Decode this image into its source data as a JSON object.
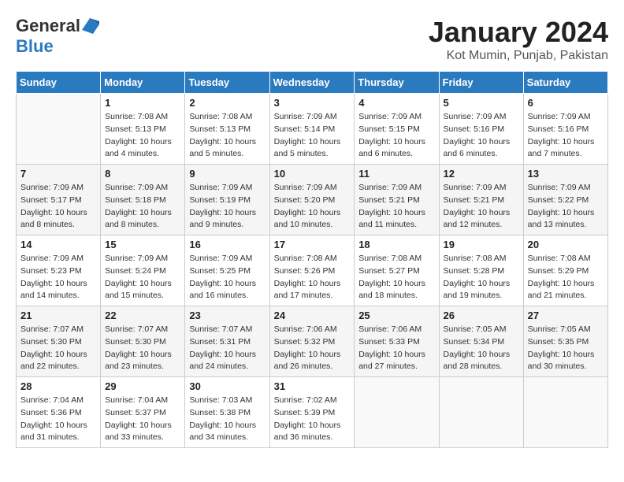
{
  "logo": {
    "general": "General",
    "blue": "Blue"
  },
  "title": "January 2024",
  "subtitle": "Kot Mumin, Punjab, Pakistan",
  "days_of_week": [
    "Sunday",
    "Monday",
    "Tuesday",
    "Wednesday",
    "Thursday",
    "Friday",
    "Saturday"
  ],
  "weeks": [
    [
      {
        "day": "",
        "sunrise": "",
        "sunset": "",
        "daylight": ""
      },
      {
        "day": "1",
        "sunrise": "Sunrise: 7:08 AM",
        "sunset": "Sunset: 5:13 PM",
        "daylight": "Daylight: 10 hours and 4 minutes."
      },
      {
        "day": "2",
        "sunrise": "Sunrise: 7:08 AM",
        "sunset": "Sunset: 5:13 PM",
        "daylight": "Daylight: 10 hours and 5 minutes."
      },
      {
        "day": "3",
        "sunrise": "Sunrise: 7:09 AM",
        "sunset": "Sunset: 5:14 PM",
        "daylight": "Daylight: 10 hours and 5 minutes."
      },
      {
        "day": "4",
        "sunrise": "Sunrise: 7:09 AM",
        "sunset": "Sunset: 5:15 PM",
        "daylight": "Daylight: 10 hours and 6 minutes."
      },
      {
        "day": "5",
        "sunrise": "Sunrise: 7:09 AM",
        "sunset": "Sunset: 5:16 PM",
        "daylight": "Daylight: 10 hours and 6 minutes."
      },
      {
        "day": "6",
        "sunrise": "Sunrise: 7:09 AM",
        "sunset": "Sunset: 5:16 PM",
        "daylight": "Daylight: 10 hours and 7 minutes."
      }
    ],
    [
      {
        "day": "7",
        "sunrise": "Sunrise: 7:09 AM",
        "sunset": "Sunset: 5:17 PM",
        "daylight": "Daylight: 10 hours and 8 minutes."
      },
      {
        "day": "8",
        "sunrise": "Sunrise: 7:09 AM",
        "sunset": "Sunset: 5:18 PM",
        "daylight": "Daylight: 10 hours and 8 minutes."
      },
      {
        "day": "9",
        "sunrise": "Sunrise: 7:09 AM",
        "sunset": "Sunset: 5:19 PM",
        "daylight": "Daylight: 10 hours and 9 minutes."
      },
      {
        "day": "10",
        "sunrise": "Sunrise: 7:09 AM",
        "sunset": "Sunset: 5:20 PM",
        "daylight": "Daylight: 10 hours and 10 minutes."
      },
      {
        "day": "11",
        "sunrise": "Sunrise: 7:09 AM",
        "sunset": "Sunset: 5:21 PM",
        "daylight": "Daylight: 10 hours and 11 minutes."
      },
      {
        "day": "12",
        "sunrise": "Sunrise: 7:09 AM",
        "sunset": "Sunset: 5:21 PM",
        "daylight": "Daylight: 10 hours and 12 minutes."
      },
      {
        "day": "13",
        "sunrise": "Sunrise: 7:09 AM",
        "sunset": "Sunset: 5:22 PM",
        "daylight": "Daylight: 10 hours and 13 minutes."
      }
    ],
    [
      {
        "day": "14",
        "sunrise": "Sunrise: 7:09 AM",
        "sunset": "Sunset: 5:23 PM",
        "daylight": "Daylight: 10 hours and 14 minutes."
      },
      {
        "day": "15",
        "sunrise": "Sunrise: 7:09 AM",
        "sunset": "Sunset: 5:24 PM",
        "daylight": "Daylight: 10 hours and 15 minutes."
      },
      {
        "day": "16",
        "sunrise": "Sunrise: 7:09 AM",
        "sunset": "Sunset: 5:25 PM",
        "daylight": "Daylight: 10 hours and 16 minutes."
      },
      {
        "day": "17",
        "sunrise": "Sunrise: 7:08 AM",
        "sunset": "Sunset: 5:26 PM",
        "daylight": "Daylight: 10 hours and 17 minutes."
      },
      {
        "day": "18",
        "sunrise": "Sunrise: 7:08 AM",
        "sunset": "Sunset: 5:27 PM",
        "daylight": "Daylight: 10 hours and 18 minutes."
      },
      {
        "day": "19",
        "sunrise": "Sunrise: 7:08 AM",
        "sunset": "Sunset: 5:28 PM",
        "daylight": "Daylight: 10 hours and 19 minutes."
      },
      {
        "day": "20",
        "sunrise": "Sunrise: 7:08 AM",
        "sunset": "Sunset: 5:29 PM",
        "daylight": "Daylight: 10 hours and 21 minutes."
      }
    ],
    [
      {
        "day": "21",
        "sunrise": "Sunrise: 7:07 AM",
        "sunset": "Sunset: 5:30 PM",
        "daylight": "Daylight: 10 hours and 22 minutes."
      },
      {
        "day": "22",
        "sunrise": "Sunrise: 7:07 AM",
        "sunset": "Sunset: 5:30 PM",
        "daylight": "Daylight: 10 hours and 23 minutes."
      },
      {
        "day": "23",
        "sunrise": "Sunrise: 7:07 AM",
        "sunset": "Sunset: 5:31 PM",
        "daylight": "Daylight: 10 hours and 24 minutes."
      },
      {
        "day": "24",
        "sunrise": "Sunrise: 7:06 AM",
        "sunset": "Sunset: 5:32 PM",
        "daylight": "Daylight: 10 hours and 26 minutes."
      },
      {
        "day": "25",
        "sunrise": "Sunrise: 7:06 AM",
        "sunset": "Sunset: 5:33 PM",
        "daylight": "Daylight: 10 hours and 27 minutes."
      },
      {
        "day": "26",
        "sunrise": "Sunrise: 7:05 AM",
        "sunset": "Sunset: 5:34 PM",
        "daylight": "Daylight: 10 hours and 28 minutes."
      },
      {
        "day": "27",
        "sunrise": "Sunrise: 7:05 AM",
        "sunset": "Sunset: 5:35 PM",
        "daylight": "Daylight: 10 hours and 30 minutes."
      }
    ],
    [
      {
        "day": "28",
        "sunrise": "Sunrise: 7:04 AM",
        "sunset": "Sunset: 5:36 PM",
        "daylight": "Daylight: 10 hours and 31 minutes."
      },
      {
        "day": "29",
        "sunrise": "Sunrise: 7:04 AM",
        "sunset": "Sunset: 5:37 PM",
        "daylight": "Daylight: 10 hours and 33 minutes."
      },
      {
        "day": "30",
        "sunrise": "Sunrise: 7:03 AM",
        "sunset": "Sunset: 5:38 PM",
        "daylight": "Daylight: 10 hours and 34 minutes."
      },
      {
        "day": "31",
        "sunrise": "Sunrise: 7:02 AM",
        "sunset": "Sunset: 5:39 PM",
        "daylight": "Daylight: 10 hours and 36 minutes."
      },
      {
        "day": "",
        "sunrise": "",
        "sunset": "",
        "daylight": ""
      },
      {
        "day": "",
        "sunrise": "",
        "sunset": "",
        "daylight": ""
      },
      {
        "day": "",
        "sunrise": "",
        "sunset": "",
        "daylight": ""
      }
    ]
  ],
  "colors": {
    "header_bg": "#2a7abf",
    "header_text": "#ffffff",
    "accent": "#2a7abf"
  }
}
